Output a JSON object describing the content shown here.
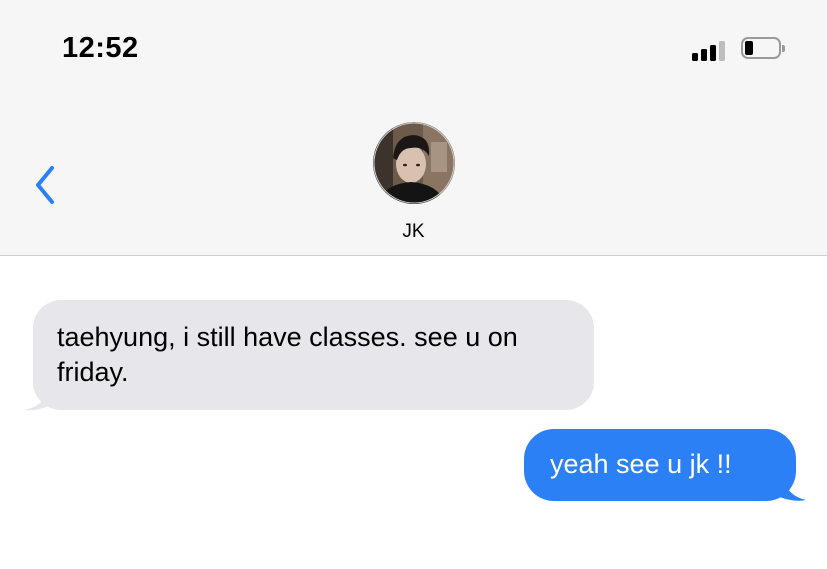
{
  "status_bar": {
    "time": "12:52",
    "signal_icon": "cellular-signal-icon",
    "battery_icon": "battery-low-icon"
  },
  "header": {
    "back_icon": "chevron-left-icon",
    "contact_name": "JK",
    "avatar": "contact-photo"
  },
  "messages": [
    {
      "direction": "received",
      "text": "taehyung, i still have classes. see u on friday."
    },
    {
      "direction": "sent",
      "text": "yeah see u jk !!"
    }
  ],
  "colors": {
    "accent": "#2b80f6",
    "received_bubble": "#e7e6eb",
    "header_bg": "#f6f6f6"
  }
}
